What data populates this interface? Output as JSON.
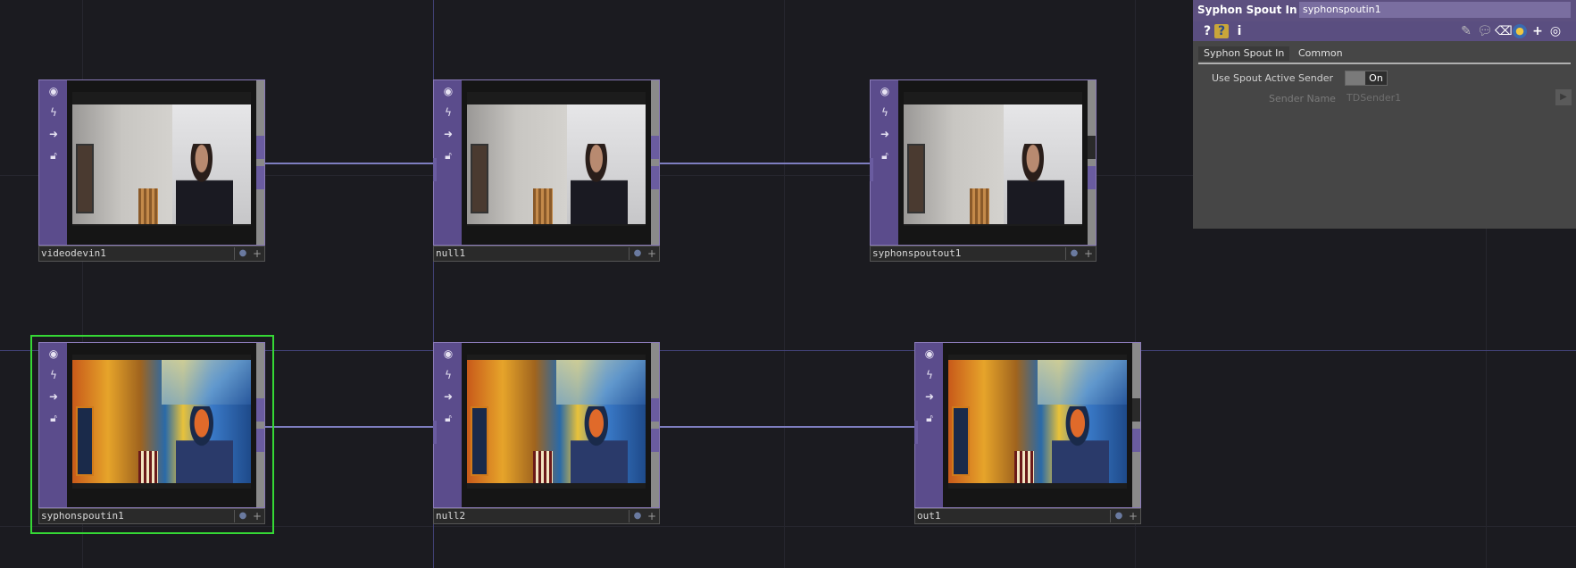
{
  "network": {
    "nodes": [
      {
        "id": "videodevin1",
        "name": "videodevin1",
        "image": "camera-feed"
      },
      {
        "id": "null1",
        "name": "null1",
        "image": "camera-feed"
      },
      {
        "id": "syphonspoutout1",
        "name": "syphonspoutout1",
        "image": "camera-feed"
      },
      {
        "id": "syphonspoutin1",
        "name": "syphonspoutin1",
        "image": "stylized-feed",
        "selected": true
      },
      {
        "id": "null2",
        "name": "null2",
        "image": "stylized-feed"
      },
      {
        "id": "out1",
        "name": "out1",
        "image": "stylized-feed"
      }
    ],
    "node_buttons": [
      "viewer-icon",
      "bypass-icon",
      "arrow-right-icon",
      "lock-icon"
    ],
    "colors": {
      "background": "#1b1b20",
      "node": "#6c5c9c",
      "wire": "#7e7ec0",
      "selection": "#35d835"
    }
  },
  "panel": {
    "op_type": "Syphon Spout In",
    "op_name": "syphonspoutin1",
    "toolbar": {
      "help": "?",
      "python_help": "?",
      "info": "i",
      "icons": [
        "pencil-icon",
        "comment-icon",
        "eraser-icon",
        "python-icon",
        "plus-icon",
        "target-icon"
      ]
    },
    "tabs": [
      "Syphon Spout In",
      "Common"
    ],
    "params": {
      "use_active_sender_label": "Use Spout Active Sender",
      "use_active_sender_value": "On",
      "sender_name_label": "Sender Name",
      "sender_name_value": "TDSender1"
    }
  }
}
